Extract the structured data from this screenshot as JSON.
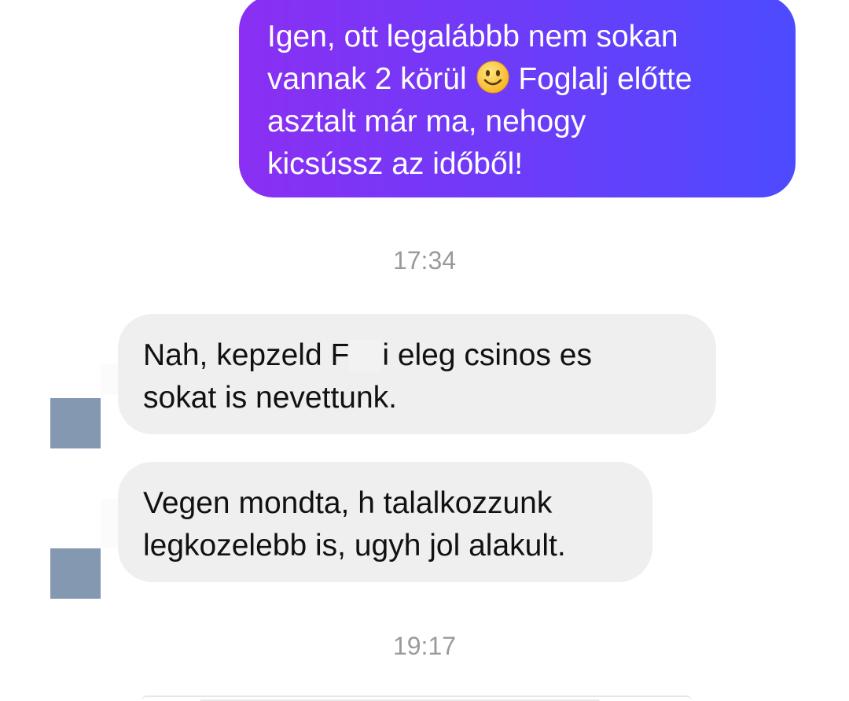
{
  "conversation": {
    "outgoing": {
      "lines": [
        "Igen, ott legalábbb nem sokan",
        "vannak 2 körül",
        "Foglalj előtte",
        "asztalt már ma, nehogy",
        "kicsússz az időből!"
      ],
      "emoji": "slightly-smiling-face-icon"
    },
    "timestamps": [
      "17:34",
      "19:17"
    ],
    "incoming": [
      {
        "lines": [
          "Nah, kepzeld F",
          "i eleg csinos es",
          "sokat is nevettunk."
        ]
      },
      {
        "lines": [
          "Vegen mondta, h talalkozzunk",
          "legkozelebb is, ugyh jol alakult."
        ]
      }
    ]
  },
  "colors": {
    "outgoing_gradient_start": "#8a2ff3",
    "outgoing_gradient_end": "#4d4bff",
    "incoming_bubble": "#efefef",
    "timestamp_text": "#9a9a9a",
    "avatar_placeholder": "#8598b1"
  }
}
